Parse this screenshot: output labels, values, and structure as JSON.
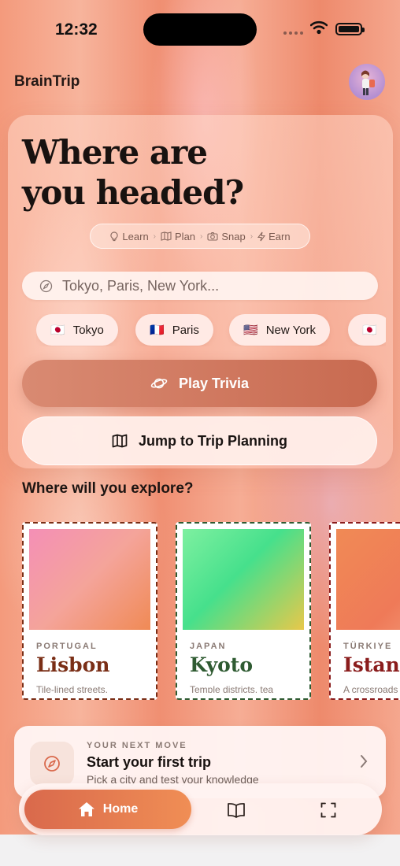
{
  "status_bar": {
    "time": "12:32"
  },
  "app": {
    "brand": "BrainTrip"
  },
  "hero": {
    "title": "Where are you headed?",
    "steps": [
      {
        "label": "Learn",
        "icon": "lightbulb-icon"
      },
      {
        "label": "Plan",
        "icon": "map-icon"
      },
      {
        "label": "Snap",
        "icon": "camera-icon"
      },
      {
        "label": "Earn",
        "icon": "bolt-icon"
      }
    ]
  },
  "search": {
    "placeholder": "Tokyo, Paris, New York...",
    "icon": "compass-icon"
  },
  "city_chips": [
    {
      "label": "Tokyo",
      "flag": "🇯🇵"
    },
    {
      "label": "Paris",
      "flag": "🇫🇷"
    },
    {
      "label": "New York",
      "flag": "🇺🇸"
    },
    {
      "label": "",
      "flag": "🇯🇵"
    }
  ],
  "actions": {
    "play_trivia": "Play Trivia",
    "jump_planning": "Jump to Trip Planning"
  },
  "explore": {
    "title": "Where will you explore?",
    "destinations": [
      {
        "country": "PORTUGAL",
        "city": "Lisbon",
        "desc": "Tile-lined streets,",
        "color": "#7a2e16",
        "edge": "#7a2e16"
      },
      {
        "country": "JAPAN",
        "city": "Kyoto",
        "desc": "Temple districts, tea",
        "color": "#2f5b32",
        "edge": "#2f5b32"
      },
      {
        "country": "TÜRKIYE",
        "city": "Istanbul",
        "desc": "A crossroads",
        "color": "#8a1c1c",
        "edge": "#8a1c1c"
      }
    ]
  },
  "next_move": {
    "kicker": "YOUR NEXT MOVE",
    "title": "Start your first trip",
    "subtitle": "Pick a city and test your knowledge"
  },
  "tabbar": {
    "home": "Home",
    "items": [
      "home-icon",
      "book-icon",
      "scan-icon"
    ]
  },
  "colors": {
    "accent": "#d9694c",
    "trivia": "#c86a50",
    "background": "#f49a7c"
  }
}
